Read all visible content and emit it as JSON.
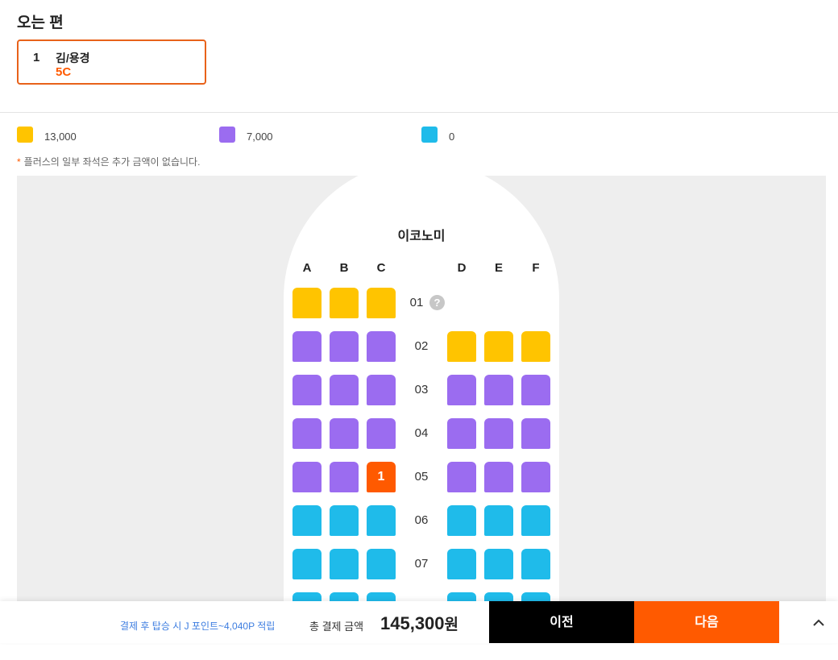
{
  "header": {
    "title": "오는 편"
  },
  "passenger": {
    "number": "1",
    "name": "김/용경",
    "seat": "5C"
  },
  "legend": [
    {
      "color": "#ffc400",
      "price": "13,000"
    },
    {
      "color": "#9b6cf0",
      "price": "7,000"
    },
    {
      "color": "#1fbbea",
      "price": "0"
    }
  ],
  "note": {
    "star": "*",
    "text": "플러스의 일부 좌석은 추가 금액이 없습니다."
  },
  "seatmap": {
    "cabin": "이코노미",
    "columns": [
      "A",
      "B",
      "C",
      "D",
      "E",
      "F"
    ],
    "help_icon": "?",
    "rows": [
      {
        "label": "01",
        "seats": [
          "yellow",
          "yellow",
          "yellow",
          null,
          null,
          null
        ],
        "help": true
      },
      {
        "label": "02",
        "seats": [
          "purple",
          "purple",
          "purple",
          "yellow",
          "yellow",
          "yellow"
        ]
      },
      {
        "label": "03",
        "seats": [
          "purple",
          "purple",
          "purple",
          "purple",
          "purple",
          "purple"
        ]
      },
      {
        "label": "04",
        "seats": [
          "purple",
          "purple",
          "purple",
          "purple",
          "purple",
          "purple"
        ]
      },
      {
        "label": "05",
        "seats": [
          "purple",
          "purple",
          "selected",
          "purple",
          "purple",
          "purple"
        ],
        "selected_label": "1"
      },
      {
        "label": "06",
        "seats": [
          "blue",
          "blue",
          "blue",
          "blue",
          "blue",
          "blue"
        ]
      },
      {
        "label": "07",
        "seats": [
          "blue",
          "blue",
          "blue",
          "blue",
          "blue",
          "blue"
        ]
      },
      {
        "label": "",
        "seats": [
          "blue",
          "blue",
          "blue",
          "blue",
          "blue",
          "blue"
        ]
      }
    ],
    "colors": {
      "yellow": "#ffc400",
      "purple": "#9b6cf0",
      "blue": "#1fbbea",
      "selected": "#ff5a00"
    }
  },
  "footer": {
    "points_text": "결제 후 탑승 시 J 포인트~4,040P 적립",
    "total_label": "총 결제 금액",
    "total_amount": "145,300",
    "currency": "원",
    "prev_label": "이전",
    "next_label": "다음",
    "expand_icon": "chevron-up-icon"
  }
}
